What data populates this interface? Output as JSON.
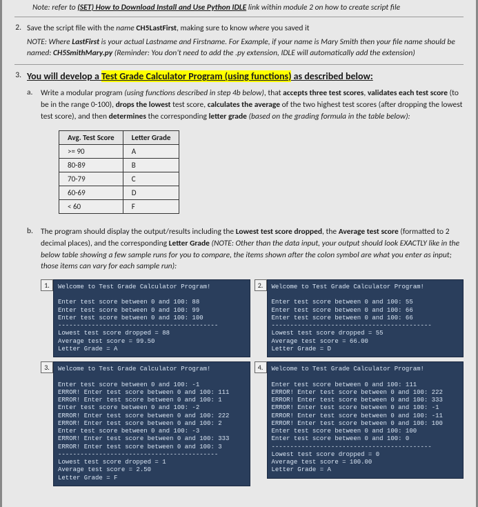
{
  "top_note_prefix": "Note: refer to ",
  "top_note_link": "(SET) How to Download Install and Use Python IDLE",
  "top_note_suffix": " link within module 2 on how to create script file",
  "item2": {
    "num": "2.",
    "line1_a": "Save the script file with the ",
    "line1_name": "name",
    "line1_b": " ",
    "line1_file": "CH5LastFirst",
    "line1_c": ", making sure to know ",
    "line1_where": "where",
    "line1_d": " you saved it",
    "note_a": "NOTE: Where ",
    "note_lf": "LastFirst",
    "note_b": " is your actual Lastname and Firstname.  For Example, if your name is Mary Smith then your file name should be named: ",
    "note_file": "CH5SmithMary.py",
    "note_c": " (Reminder: You don't need to add the .py extension, IDLE will automatically add the extension)"
  },
  "item3": {
    "num": "3.",
    "head_a": "You will develop a ",
    "head_hl": "Test Grade Calculator Program (using functions)",
    "head_b": " as described below:"
  },
  "sub_a": {
    "letter": "a.",
    "t1": "Write a modular program ",
    "t2": "(using functions described in step 4b below)",
    "t3": ", that ",
    "t4": "accepts three test scores",
    "t5": ", ",
    "t6": "validates each test score",
    "t7": " (to be in the range 0-100), ",
    "t8": "drops the lowest",
    "t9": " test score, ",
    "t10": "calculates the average",
    "t11": " of the two highest test scores (after dropping the lowest test score), and then ",
    "t12": "determines",
    "t13": " the corresponding ",
    "t14": "letter grade",
    "t15": " ",
    "t16": "(based on the grading formula in the table below):"
  },
  "grade_table": {
    "h1": "Avg. Test Score",
    "h2": "Letter Grade",
    "rows": [
      {
        "score": ">= 90",
        "grade": "A"
      },
      {
        "score": "80-89",
        "grade": "B"
      },
      {
        "score": "70-79",
        "grade": "C"
      },
      {
        "score": "60-69",
        "grade": "D"
      },
      {
        "score": "< 60",
        "grade": "F"
      }
    ]
  },
  "sub_b": {
    "letter": "b.",
    "t1": "The program should display the output/results including the ",
    "t2": "Lowest test score dropped",
    "t3": ", the ",
    "t4": "Average test score",
    "t5": " (formatted to 2 decimal places), and the corresponding ",
    "t6": "Letter Grade",
    "t7": " ",
    "t8": "(NOTE: Other than the data input, your output should look EXACTLY like in the below table showing a few sample runs for you to compare, the items shown after the colon symbol are what you enter as input; those items can vary for each sample run):"
  },
  "terminals": [
    {
      "num": "1.",
      "text": "Welcome to Test Grade Calculator Program!\n\nEnter test score between 0 and 100: 88\nEnter test score between 0 and 100: 99\nEnter test score between 0 and 100: 100\n-------------------------------------------\nLowest test score dropped = 88\nAverage test score = 99.50\nLetter Grade = A"
    },
    {
      "num": "2.",
      "text": "Welcome to Test Grade Calculator Program!\n\nEnter test score between 0 and 100: 55\nEnter test score between 0 and 100: 66\nEnter test score between 0 and 100: 66\n-------------------------------------------\nLowest test score dropped = 55\nAverage test score = 66.00\nLetter Grade = D"
    },
    {
      "num": "3.",
      "text": "Welcome to Test Grade Calculator Program!\n\nEnter test score between 0 and 100: -1\nERROR! Enter test score between 0 and 100: 111\nERROR! Enter test score between 0 and 100: 1\nEnter test score between 0 and 100: -2\nERROR! Enter test score between 0 and 100: 222\nERROR! Enter test score between 0 and 100: 2\nEnter test score between 0 and 100: -3\nERROR! Enter test score between 0 and 100: 333\nERROR! Enter test score between 0 and 100: 3\n-------------------------------------------\nLowest test score dropped = 1\nAverage test score = 2.50\nLetter Grade = F"
    },
    {
      "num": "4.",
      "text": "Welcome to Test Grade Calculator Program!\n\nEnter test score between 0 and 100: 111\nERROR! Enter test score between 0 and 100: 222\nERROR! Enter test score between 0 and 100: 333\nERROR! Enter test score between 0 and 100: -1\nERROR! Enter test score between 0 and 100: -11\nERROR! Enter test score between 0 and 100: 100\nEnter test score between 0 and 100: 100\nEnter test score between 0 and 100: 0\n-------------------------------------------\nLowest test score dropped = 0\nAverage test score = 100.00\nLetter Grade = A"
    }
  ],
  "footer": ""
}
